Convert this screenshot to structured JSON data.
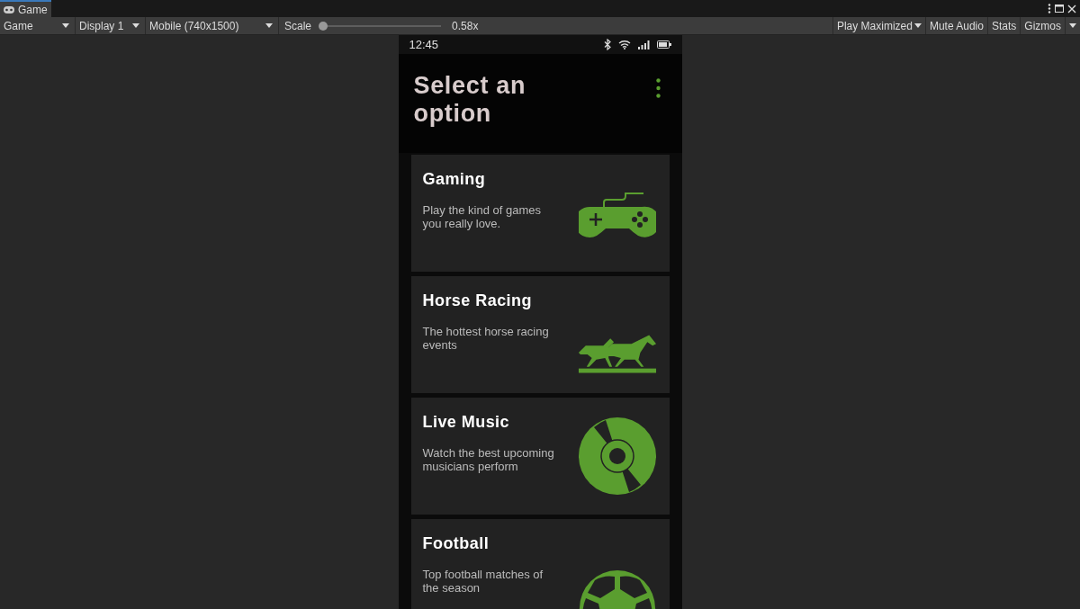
{
  "tab": {
    "label": "Game",
    "selected": true
  },
  "toolbar": {
    "left": [
      {
        "label": "Game",
        "kind": "dropdown"
      },
      {
        "label": "Display 1",
        "kind": "dropdown"
      },
      {
        "label": "Mobile (740x1500)",
        "kind": "dropdown"
      }
    ],
    "scale": {
      "label": "Scale",
      "level": 0,
      "reading": "0.58x"
    },
    "right": [
      {
        "label": "Play Maximized",
        "kind": "dropdown"
      },
      {
        "label": "Mute Audio",
        "kind": "toggle"
      },
      {
        "label": "Stats",
        "kind": "toggle"
      },
      {
        "label": "Gizmos",
        "kind": "toggle"
      }
    ]
  },
  "phone": {
    "status_bar": {
      "time": "12:45"
    },
    "title": "Select an option",
    "cards": [
      {
        "title": "Gaming",
        "description": "Play the kind of games you really love.",
        "kind": "gamepad"
      },
      {
        "title": "Horse Racing",
        "description": "The hottest horse racing events",
        "kind": "horses"
      },
      {
        "title": "Live Music",
        "description": "Watch the best upcoming musicians perform",
        "kind": "disc"
      },
      {
        "title": "Football",
        "description": "Top football matches of the season",
        "kind": "ball"
      }
    ]
  }
}
